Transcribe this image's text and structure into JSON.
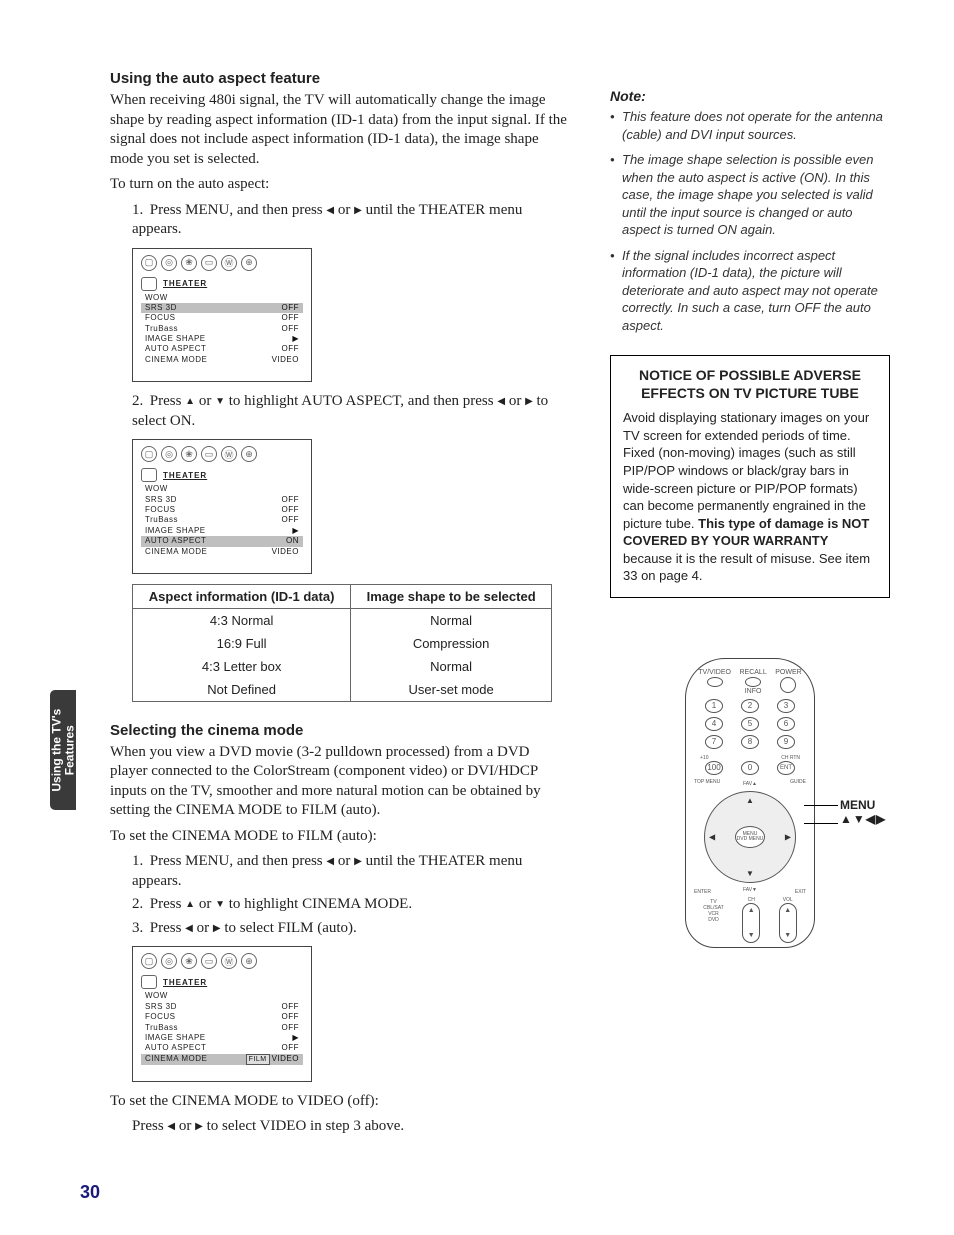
{
  "side_tab": "Using the TV's\nFeatures",
  "page_number": "30",
  "section1": {
    "heading": "Using the auto aspect feature",
    "para1": "When receiving 480i signal, the TV will automatically change the image shape by reading aspect information (ID-1 data) from the input signal. If the signal does not include aspect information (ID-1 data), the image shape mode you set is selected.",
    "para2": "To turn on the auto aspect:",
    "step1_a": "Press MENU, and then press ",
    "step1_b": " or ",
    "step1_c": " until the THEATER menu appears.",
    "step2_a": "Press ",
    "step2_b": " or ",
    "step2_c": " to highlight AUTO ASPECT, and then press ",
    "step2_d": " or ",
    "step2_e": " to select ON."
  },
  "menu": {
    "title": "THEATER",
    "rows": [
      {
        "l": "WOW",
        "r": ""
      },
      {
        "l": "SRS 3D",
        "r": "OFF"
      },
      {
        "l": "FOCUS",
        "r": "OFF"
      },
      {
        "l": "TruBass",
        "r": "OFF"
      },
      {
        "l": "IMAGE SHAPE",
        "r": "▶"
      },
      {
        "l": "AUTO ASPECT",
        "r": "OFF"
      },
      {
        "l": "CINEMA MODE",
        "r": "VIDEO"
      }
    ],
    "menu2_auto_r": "ON",
    "menu3_cinema_l": "FILM",
    "menu3_cinema_r": "VIDEO"
  },
  "table": {
    "head_a": "Aspect information (ID-1 data)",
    "head_b": "Image shape to be selected",
    "rows": [
      {
        "a": "4:3 Normal",
        "b": "Normal"
      },
      {
        "a": "16:9 Full",
        "b": "Compression"
      },
      {
        "a": "4:3 Letter box",
        "b": "Normal"
      },
      {
        "a": "Not Defined",
        "b": "User-set mode"
      }
    ]
  },
  "section2": {
    "heading": "Selecting the cinema mode",
    "para1": "When you view a DVD movie (3-2 pulldown processed) from a DVD player connected to the ColorStream (component video) or DVI/HDCP inputs on the TV, smoother and more natural motion can be obtained by setting the CINEMA MODE to FILM (auto).",
    "para2": "To set the CINEMA MODE to FILM (auto):",
    "s1a": "Press MENU, and then press ",
    "s1b": " or ",
    "s1c": " until the THEATER menu appears.",
    "s2a": "Press ",
    "s2b": " or ",
    "s2c": " to highlight CINEMA MODE.",
    "s3a": "Press ",
    "s3b": " or ",
    "s3c": " to select FILM (auto).",
    "para3": "To set the CINEMA MODE to VIDEO (off):",
    "para4a": "Press ",
    "para4b": " or ",
    "para4c": " to select VIDEO in step 3 above."
  },
  "note": {
    "head": "Note:",
    "items": [
      "This feature does not operate for the antenna (cable) and DVI input sources.",
      "The image shape selection is possible even when the auto aspect is active (ON). In this case, the image shape you selected is valid until the input source is changed or auto aspect is turned ON again.",
      "If the signal includes incorrect aspect information (ID-1 data), the picture will deteriorate and auto aspect may not operate correctly. In such a case, turn OFF the auto aspect."
    ]
  },
  "notice": {
    "title": "NOTICE OF POSSIBLE ADVERSE EFFECTS ON TV PICTURE TUBE",
    "body_a": "Avoid displaying stationary images on your TV screen for extended periods of time. Fixed (non-moving) images (such as still PIP/POP windows or black/gray bars in wide-screen picture or PIP/POP formats) can become permanently engrained in the picture tube. ",
    "body_bold": "This type of damage is NOT COVERED BY YOUR WARRANTY",
    "body_b": " because it is the result of misuse. See item 33 on page 4."
  },
  "remote": {
    "top": {
      "a": "TV/VIDEO",
      "b": "RECALL",
      "c": "POWER",
      "info": "INFO"
    },
    "plus10": "+10",
    "chrtn": "CH RTN",
    "ent": "ENT",
    "center": "MENU\nDVD MENU",
    "fav_up": "FAV▲",
    "fav_down": "FAV▼",
    "corners": {
      "tl": "TOP MENU",
      "tr": "GUIDE",
      "bl": "ENTER",
      "br": "EXIT"
    },
    "ch": "CH",
    "vol": "VOL",
    "mode": "TV\nCBL/SAT\nVCR\nDVD",
    "callout_a": "MENU",
    "callout_b": "▲▼◀▶"
  },
  "arrows": {
    "left": "◀",
    "right": "▶",
    "up": "▲",
    "down": "▼"
  }
}
